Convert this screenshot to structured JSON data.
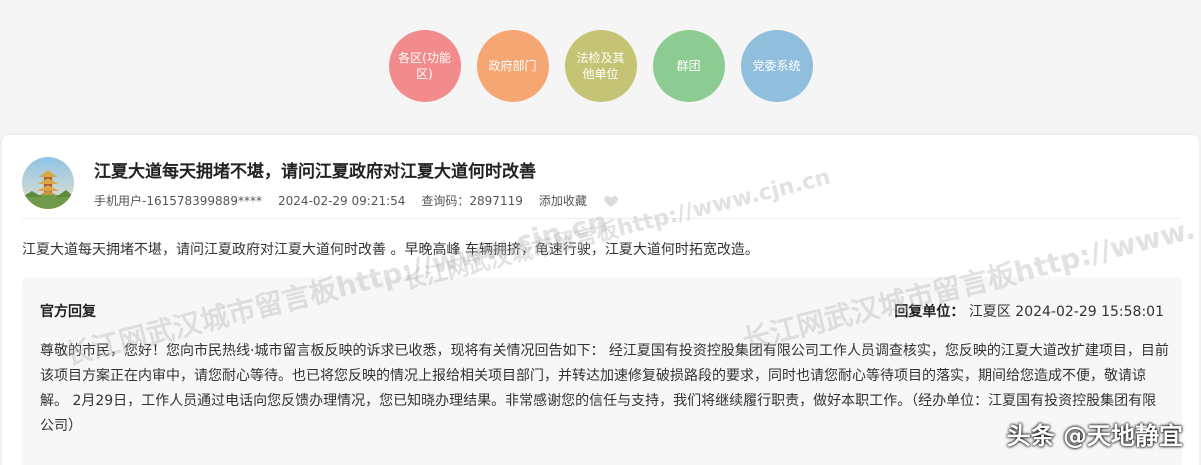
{
  "categories": [
    {
      "label": "各区(功能区)",
      "color": "#f28b8c"
    },
    {
      "label": "政府部门",
      "color": "#f6a672"
    },
    {
      "label": "法检及其他单位",
      "color": "#c5c474"
    },
    {
      "label": "群团",
      "color": "#8ccc92"
    },
    {
      "label": "党委系统",
      "color": "#8fbfdc"
    }
  ],
  "post": {
    "title": "江夏大道每天拥堵不堪，请问江夏政府对江夏大道何时改善",
    "author": "手机用户-161578399889****",
    "datetime": "2024-02-29 09:21:54",
    "query_code": "查询码：2897119",
    "favorite_label": "添加收藏",
    "content": "江夏大道每天拥堵不堪，请问江夏政府对江夏大道何时改善 。早晚高峰 车辆拥挤，龟速行驶，江夏大道何时拓宽改造。"
  },
  "reply": {
    "label": "官方回复",
    "unit_label": "回复单位：",
    "unit": "江夏区",
    "datetime": "2024-02-29 15:58:01",
    "body": "尊敬的市民，您好！您向市民热线·城市留言板反映的诉求已收悉，现将有关情况回告如下： 经江夏国有投资控股集团有限公司工作人员调查核实，您反映的江夏大道改扩建项目，目前该项目方案正在内审中，请您耐心等待。也已将您反映的情况上报给相关项目部门，并转达加速修复破损路段的要求，同时也请您耐心等待项目的落实，期间给您造成不便，敬请谅解。 2月29日，工作人员通过电话向您反馈办理情况，您已知晓办理结果。非常感谢您的信任与支持，我们将继续履行职责，做好本职工作。（经办单位：江夏国有投资控股集团有限公司）"
  },
  "watermarks": {
    "a": "长江网武汉城市留言板http://www.cjn.cn",
    "b": "长江网武汉城市留言板http://www."
  },
  "corner_credit": "头条 @天地静宜"
}
